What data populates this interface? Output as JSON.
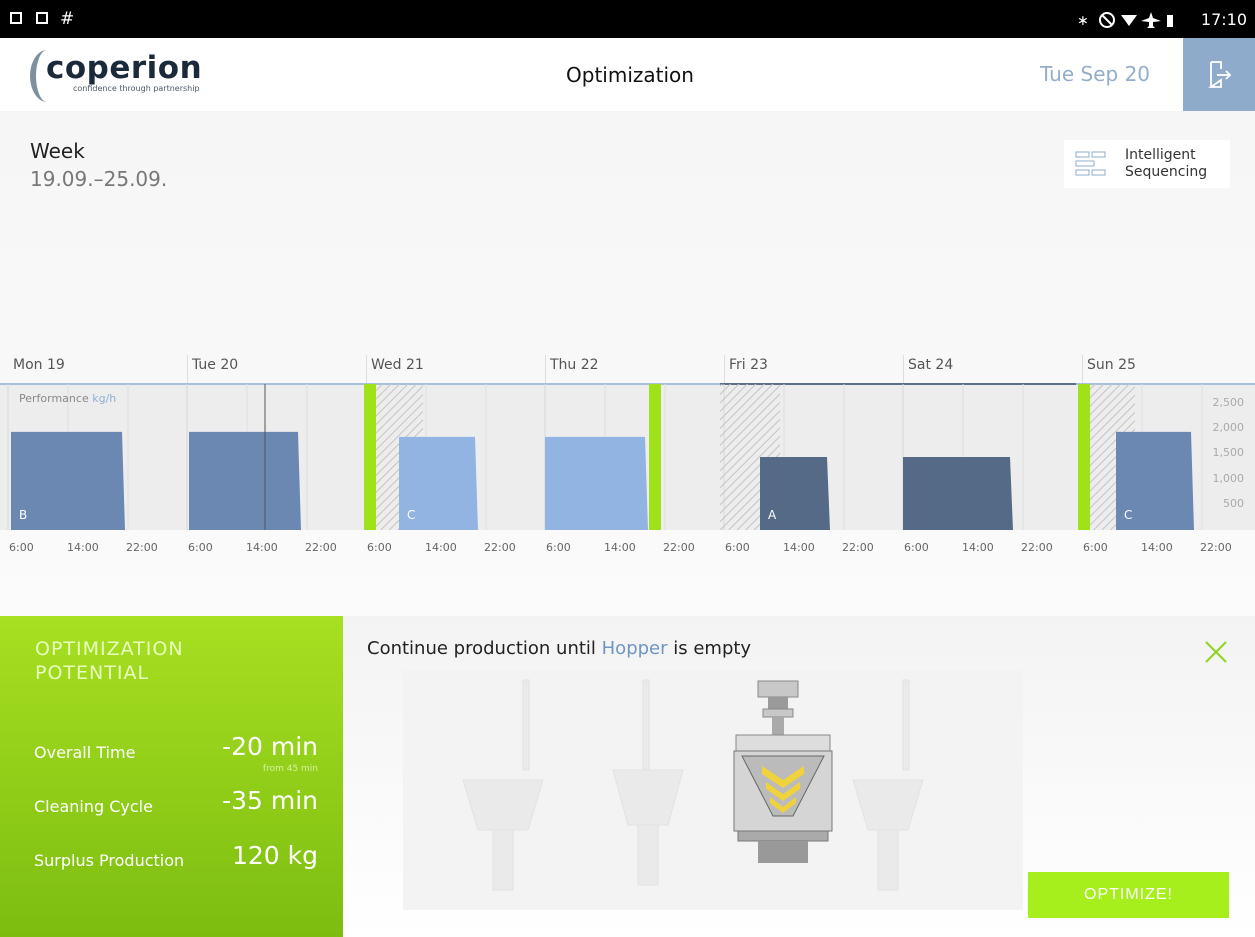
{
  "status_bar": {
    "time": "17:10",
    "hash": "#"
  },
  "header": {
    "logo_text": "coperion",
    "logo_tagline": "confidence through partnership",
    "title": "Optimization",
    "date": "Tue Sep 20"
  },
  "week": {
    "label": "Week",
    "range": "19.09.–25.09."
  },
  "intelligent_sequencing": {
    "line1": "Intelligent",
    "line2": "Sequencing"
  },
  "chart_data": {
    "type": "bar",
    "title": "",
    "ylabel_prefix": "Performance",
    "ylabel_unit": "kg/h",
    "days": [
      "Mon 19",
      "Tue 20",
      "Wed 21",
      "Thu 22",
      "Fri 23",
      "Sat 24",
      "Sun 25"
    ],
    "time_ticks": [
      "6:00",
      "14:00",
      "22:00"
    ],
    "yticks": [
      "2,500",
      "2,000",
      "1,500",
      "1,000",
      "500"
    ],
    "ylim": [
      0,
      2900
    ],
    "bars": [
      {
        "day": "Mon 19",
        "value": 1950,
        "label": "B",
        "color": "#6b88b3"
      },
      {
        "day": "Tue 20",
        "value": 1950,
        "label": "",
        "color": "#6b88b3"
      },
      {
        "day": "Wed 21",
        "value": 1850,
        "label": "C",
        "color": "#91b4e2"
      },
      {
        "day": "Thu 22",
        "value": 1850,
        "label": "",
        "color": "#91b4e2"
      },
      {
        "day": "Fri 23",
        "value": 1450,
        "label": "A",
        "color": "#546a87"
      },
      {
        "day": "Sat 24",
        "value": 1450,
        "label": "",
        "color": "#546a87"
      },
      {
        "day": "Sun 25",
        "value": 1950,
        "label": "C",
        "color": "#6b88b3"
      }
    ]
  },
  "optimization": {
    "title_line1": "OPTIMIZATION",
    "title_line2": "POTENTIAL",
    "rows": [
      {
        "label": "Overall Time",
        "value": "-20 min",
        "sub": "from 45 min"
      },
      {
        "label": "Cleaning Cycle",
        "value": "-35 min"
      },
      {
        "label": "Surplus Production",
        "value": "120 kg"
      }
    ]
  },
  "message": {
    "prefix": "Continue production until ",
    "highlight": "Hopper",
    "suffix": " is empty"
  },
  "optimize_button": "OPTIMIZE!",
  "colors": {
    "accent_green": "#a6ef1c",
    "accent_blue": "#8fabcb"
  }
}
